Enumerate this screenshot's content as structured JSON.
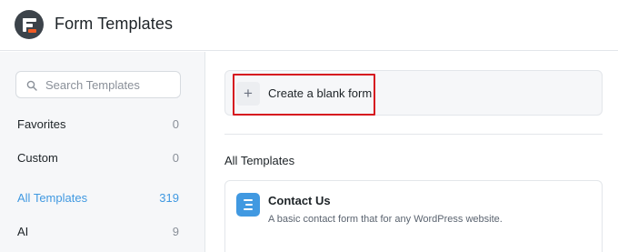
{
  "header": {
    "title": "Form Templates",
    "logo_icon": "formidable-logo"
  },
  "sidebar": {
    "search": {
      "placeholder": "Search Templates",
      "value": ""
    },
    "items": [
      {
        "label": "Favorites",
        "count": "0",
        "active": false
      },
      {
        "label": "Custom",
        "count": "0",
        "active": false
      },
      {
        "label": "All Templates",
        "count": "319",
        "active": true
      },
      {
        "label": "AI",
        "count": "9",
        "active": false
      }
    ]
  },
  "main": {
    "create_blank": {
      "label": "Create a blank form",
      "icon": "plus-icon"
    },
    "section_title": "All Templates",
    "templates": [
      {
        "name": "Contact Us",
        "description": "A basic contact form that for any WordPress website.",
        "icon": "form-lines-icon"
      }
    ]
  },
  "colors": {
    "accent": "#4199e1",
    "highlight_border": "#d6171f",
    "logo_dark": "#3c434a",
    "logo_orange": "#f05a24"
  }
}
